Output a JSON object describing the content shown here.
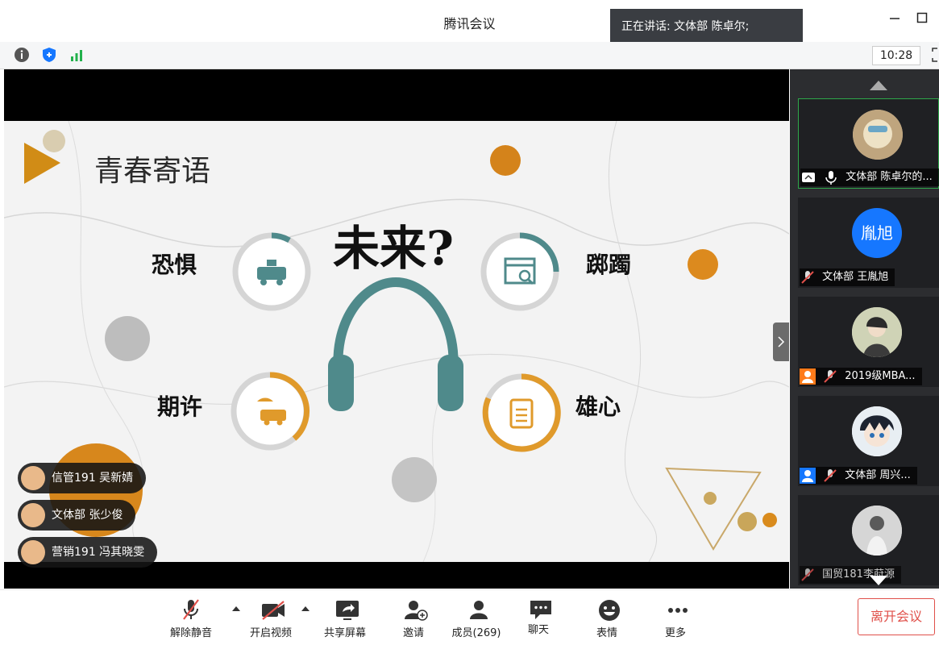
{
  "window": {
    "title": "腾讯会议",
    "speaking": "正在讲话: 文体部 陈卓尔;",
    "minimize_icon": "minimize-icon",
    "maximize_icon": "maximize-icon"
  },
  "toolbar": {
    "clock": "10:28",
    "icons": [
      "info-icon",
      "shield-icon",
      "signal-icon",
      "fullscreen-icon"
    ]
  },
  "slide": {
    "title": "青春寄语",
    "center_title": "未来?",
    "items": [
      {
        "label": "恐惧",
        "icon": "taxi-icon",
        "color": "#4f8a8b",
        "progress": 0.08
      },
      {
        "label": "踯躅",
        "icon": "browser-search-icon",
        "color": "#4f8a8b",
        "progress": 0.25
      },
      {
        "label": "期许",
        "icon": "car-umbrella-icon",
        "color": "#e09a2b",
        "progress": 0.42
      },
      {
        "label": "雄心",
        "icon": "clipboard-icon",
        "color": "#e09a2b",
        "progress": 0.68
      }
    ],
    "center_icon": "headphones-icon"
  },
  "reactions": [
    {
      "name": "信管191 吴新婧"
    },
    {
      "name": "文体部 张少俊"
    },
    {
      "name": "营销191 冯其晓雯"
    }
  ],
  "participants": [
    {
      "name": "文体部 陈卓尔的...",
      "muted": false,
      "share": true,
      "avatar_text": ""
    },
    {
      "name": "文体部 王胤旭",
      "muted": true,
      "avatar_text": "胤旭",
      "avatar_color": "#1677ff"
    },
    {
      "name": "2019级MBA...",
      "muted": true,
      "avatar_text": ""
    },
    {
      "name": "文体部 周兴...",
      "muted": true,
      "avatar_text": ""
    },
    {
      "name": "国贸181李莳源",
      "muted": true,
      "avatar_text": ""
    }
  ],
  "bottom": {
    "unmute": "解除静音",
    "video": "开启视频",
    "share": "共享屏幕",
    "invite": "邀请",
    "members": "成员(269)",
    "chat": "聊天",
    "emoji": "表情",
    "more": "更多",
    "leave": "离开会议"
  }
}
